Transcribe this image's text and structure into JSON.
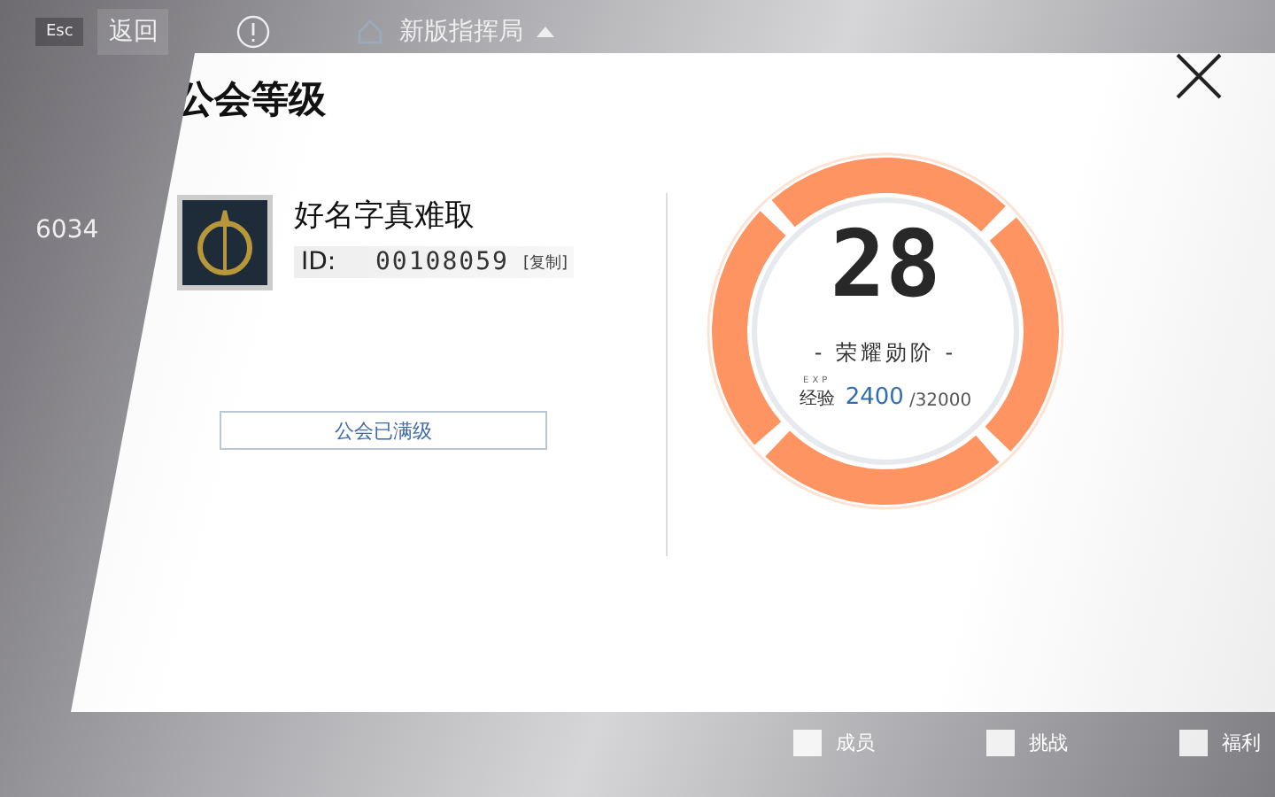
{
  "top_bar": {
    "esc_key": "Esc",
    "back": "返回",
    "location": "新版指挥局"
  },
  "background_stat": "6034",
  "dialog": {
    "title": "公会等级",
    "guild": {
      "name": "好名字真难取",
      "id_label": "ID:",
      "id": "00108059",
      "copy": "[复制]"
    },
    "status_button": "公会已满级",
    "level": {
      "value": "28",
      "rank": "- 荣耀勋阶 -",
      "exp_tag": "EXP",
      "exp_label": "经验",
      "exp_current": "2400",
      "exp_total": "/32000"
    }
  },
  "bottom_nav": [
    {
      "label": "成员"
    },
    {
      "label": "挑战"
    },
    {
      "label": "福利"
    }
  ]
}
